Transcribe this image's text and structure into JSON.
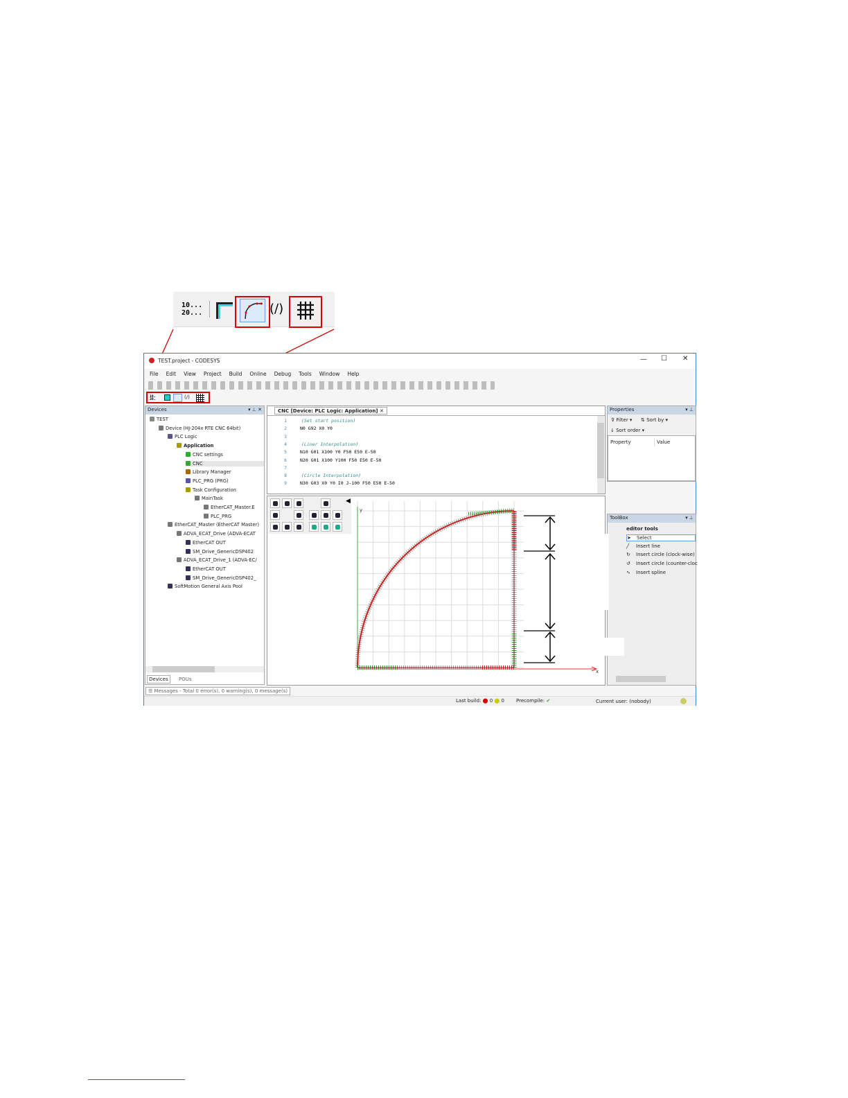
{
  "inset_toolbar": {
    "line_numbers_icon": "10...\n20...",
    "icons": [
      "line-numbers-icon",
      "layout-icon",
      "path-editor-icon",
      "code-icon",
      "table-icon"
    ],
    "code_label": "(/)"
  },
  "window": {
    "title": "TEST.project - CODESYS",
    "controls": [
      "—",
      "☐",
      "✕"
    ]
  },
  "menu": [
    "File",
    "Edit",
    "View",
    "Project",
    "Build",
    "Online",
    "Debug",
    "Tools",
    "Window",
    "Help"
  ],
  "devices": {
    "title": "Devices",
    "tree": [
      {
        "label": "TEST",
        "level": 0
      },
      {
        "label": "Device (HJ-204x RTE CNC 64bit)",
        "level": 1
      },
      {
        "label": "PLC Logic",
        "level": 2
      },
      {
        "label": "Application",
        "level": 3,
        "bold": true
      },
      {
        "label": "CNC settings",
        "level": 4
      },
      {
        "label": "CNC",
        "level": 4,
        "selected": true
      },
      {
        "label": "Library Manager",
        "level": 4
      },
      {
        "label": "PLC_PRG (PRG)",
        "level": 4
      },
      {
        "label": "Task Configuration",
        "level": 4
      },
      {
        "label": "MainTask",
        "level": 5
      },
      {
        "label": "EtherCAT_Master.E",
        "level": 6
      },
      {
        "label": "PLC_PRG",
        "level": 6
      },
      {
        "label": "EtherCAT_Master (EtherCAT Master)",
        "level": 2
      },
      {
        "label": "ADVA_ECAT_Drive (ADVA-ECAT",
        "level": 3
      },
      {
        "label": "EtherCAT OUT",
        "level": 4
      },
      {
        "label": "SM_Drive_GenericDSP402",
        "level": 4
      },
      {
        "label": "ADVA_ECAT_Drive_1 (ADVA-EC/",
        "level": 3
      },
      {
        "label": "EtherCAT OUT",
        "level": 4
      },
      {
        "label": "SM_Drive_GenericDSP402_",
        "level": 4
      },
      {
        "label": "SoftMotion General Axis Pool",
        "level": 2
      }
    ],
    "tabs": [
      "Devices",
      "POUs"
    ]
  },
  "editor": {
    "tab": "CNC [Device: PLC Logic: Application]",
    "lines": [
      {
        "n": "1",
        "text": "(Set start position)",
        "type": "comment"
      },
      {
        "n": "2",
        "text": "N0 G92 X0 Y0",
        "type": "code"
      },
      {
        "n": "3",
        "text": "",
        "type": "code"
      },
      {
        "n": "4",
        "text": "(Liner Interpolation)",
        "type": "comment"
      },
      {
        "n": "5",
        "text": "N10 G01 X100 Y0 F50 E50 E-50",
        "type": "code"
      },
      {
        "n": "6",
        "text": "N20 G01 X100 Y100 F50 E50 E-50",
        "type": "code"
      },
      {
        "n": "7",
        "text": "",
        "type": "code"
      },
      {
        "n": "8",
        "text": "(Circle Interpolation)",
        "type": "comment"
      },
      {
        "n": "9",
        "text": "N30 G03 X0 Y0 I0 J-100 F50 E50 E-50",
        "type": "code"
      }
    ]
  },
  "plot": {
    "x_label": "x",
    "y_label": "y",
    "path_colors": {
      "path": "#cc2222",
      "accel": "#22a022",
      "decel": "#e02020"
    }
  },
  "properties": {
    "title": "Properties",
    "filter": "Filter",
    "sort_by": "Sort by",
    "sort_order": "Sort order",
    "col_property": "Property",
    "col_value": "Value"
  },
  "toolbox": {
    "title": "ToolBox",
    "group": "editor tools",
    "items": [
      "Select",
      "Insert line",
      "Insert circle (clock-wise)",
      "Insert circle (counter-cloc",
      "Insert spline"
    ]
  },
  "messages": "Messages - Total 0 error(s), 0 warning(s), 0 message(s)",
  "status": {
    "last_build": "Last build:",
    "errors": "0",
    "warnings": "0",
    "precompile": "Precompile:",
    "current_user": "Current user: (nobody)"
  }
}
